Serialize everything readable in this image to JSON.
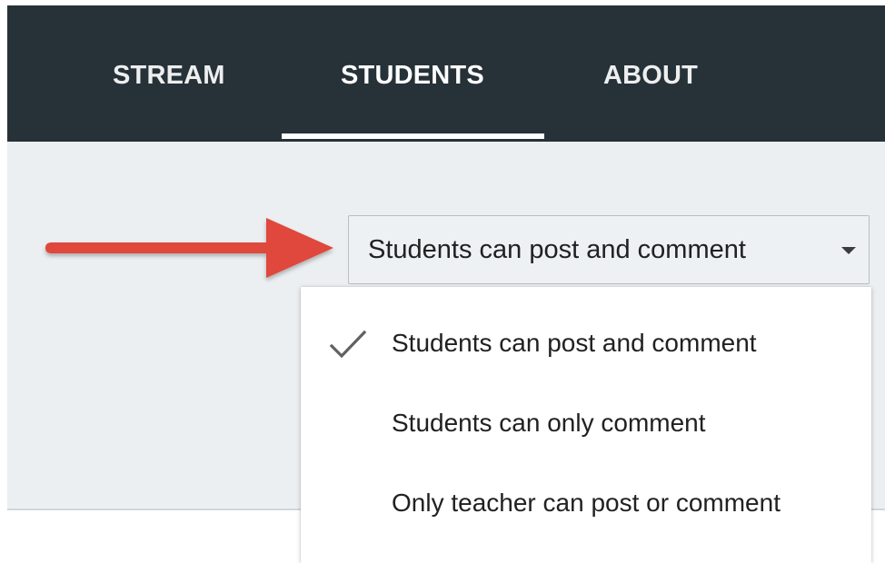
{
  "tabs": {
    "stream": "STREAM",
    "students": "STUDENTS",
    "about": "ABOUT",
    "active": "STUDENTS"
  },
  "permission_dropdown": {
    "selected_label": "Students can post and comment",
    "caret_icon": "caret-down-icon"
  },
  "permission_menu": {
    "items": [
      {
        "label": "Students can post and comment",
        "checked": true,
        "icon": "check-icon"
      },
      {
        "label": "Students can only comment",
        "checked": false
      },
      {
        "label": "Only teacher can post or comment",
        "checked": false
      }
    ]
  },
  "annotation": {
    "icon": "red-arrow-icon",
    "color": "#e0463d"
  },
  "colors": {
    "topbar": "#263238",
    "content_background": "#eceff1",
    "tab_text": "#ffffff",
    "menu_text": "#212121",
    "check": "#616161"
  }
}
